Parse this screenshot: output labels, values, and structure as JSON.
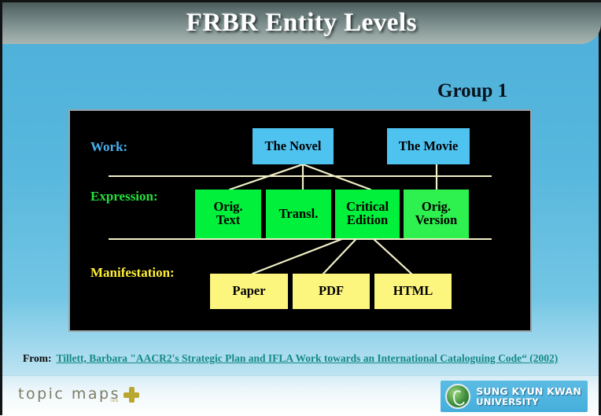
{
  "slide": {
    "title": "FRBR Entity Levels",
    "group_label": "Group 1"
  },
  "diagram": {
    "row_labels": {
      "work": "Work:",
      "expression": "Expression:",
      "manifestation": "Manifestation:"
    },
    "work_nodes": [
      {
        "label": "The Novel"
      },
      {
        "label": "The Movie"
      }
    ],
    "expression_nodes": [
      {
        "label": "Orig.\nText"
      },
      {
        "label": "Transl."
      },
      {
        "label": "Critical\nEdition"
      },
      {
        "label": "Orig.\nVersion"
      }
    ],
    "manifestation_nodes": [
      {
        "label": "Paper"
      },
      {
        "label": "PDF"
      },
      {
        "label": "HTML"
      }
    ],
    "colors": {
      "panel_background": "#000000",
      "work_box": "#4fc3f0",
      "expression_box": "#00f03c",
      "expression_box_alt": "#2ef04f",
      "manifestation_box": "#fcf57e",
      "connector_line": "#f2f0c8",
      "work_label": "#49b0f0",
      "expression_label": "#26e03c",
      "manifestation_label": "#ffef36"
    }
  },
  "citation": {
    "prefix": "From:",
    "link_text": "Tillett, Barbara \"AACR2's Strategic Plan and  IFLA Work towards an International Cataloguing Code“ (2002)",
    "link_color": "#138a85"
  },
  "footer": {
    "topicmaps_logo": {
      "wordmark": "topic maps",
      "subtext": "lab",
      "icon": "plus-cross-icon",
      "color": "#b9a730"
    },
    "university_logo": {
      "emblem": "skku-crest-icon",
      "line1": "SUNG KYUN KWAN",
      "line2": "UNIVERSITY"
    }
  }
}
